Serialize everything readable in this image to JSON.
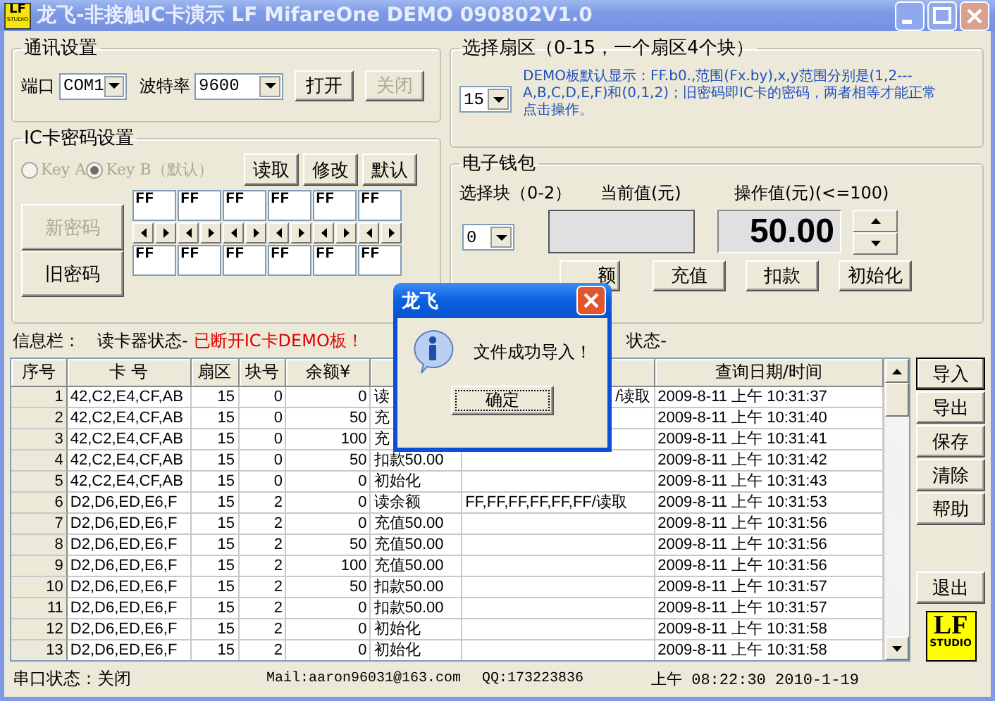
{
  "window": {
    "title": "龙飞-非接触IC卡演示 LF MifareOne DEMO 090802V1.0",
    "logo_top": "LF",
    "logo_bottom": "STUDIO"
  },
  "comm": {
    "title": "通讯设置",
    "port_label": "端口",
    "port": "COM1",
    "baud_label": "波特率",
    "baud": "9600",
    "buttons": [
      {
        "label": "打开",
        "disabled": false
      },
      {
        "label": "关闭",
        "disabled": true
      }
    ]
  },
  "password": {
    "title": "IC卡密码设置",
    "radios": [
      {
        "label": "Key A",
        "selected": false,
        "disabled": true
      },
      {
        "label": "Key B（默认）",
        "selected": true,
        "disabled": true
      }
    ],
    "buttons": [
      "读取",
      "修改",
      "默认"
    ],
    "new_button": {
      "label": "新密码",
      "disabled": true
    },
    "old_button": {
      "label": "旧密码",
      "disabled": false
    },
    "new_key": [
      "FF",
      "FF",
      "FF",
      "FF",
      "FF",
      "FF"
    ],
    "old_key": [
      "FF",
      "FF",
      "FF",
      "FF",
      "FF",
      "FF"
    ]
  },
  "sector": {
    "title": "选择扇区（0-15，一个扇区4个块）",
    "value": "15",
    "note": "DEMO板默认显示：FF.b0.,范围(Fx.by),x,y范围分别是(1,2---A,B,C,D,E,F)和(0,1,2)；旧密码即IC卡的密码，两者相等才能正常点击操作。"
  },
  "wallet": {
    "title": "电子钱包",
    "block_label": "选择块（0-2）",
    "current_label": "当前值(元)",
    "operate_label": "操作值(元)(<=100)",
    "block": "0",
    "amount": "50.00",
    "buttons": [
      "额",
      "充值",
      "扣款",
      "初始化"
    ]
  },
  "info": {
    "label": "信息栏：",
    "reader": "读卡器状态-",
    "status": "已断开IC卡DEMO板！",
    "status_tail": "状态-"
  },
  "table": {
    "columns": [
      {
        "label": "序号"
      },
      {
        "label": "卡 号"
      },
      {
        "label": "扇区"
      },
      {
        "label": "块号"
      },
      {
        "label": "余额¥"
      },
      {
        "kind": "hidden"
      },
      {
        "kind": "hidden"
      },
      {
        "label": "查询日期/时间"
      }
    ],
    "rows": [
      {
        "no": "1",
        "card": "42,C2,E4,CF,AB",
        "sector": "15",
        "block": "0",
        "balance": "0",
        "operation": "读",
        "data": "/读取",
        "time": "2009-8-11 上午 10:31:37"
      },
      {
        "no": "2",
        "card": "42,C2,E4,CF,AB",
        "sector": "15",
        "block": "0",
        "balance": "50",
        "operation": "充",
        "time": "2009-8-11 上午 10:31:40"
      },
      {
        "no": "3",
        "card": "42,C2,E4,CF,AB",
        "sector": "15",
        "block": "0",
        "balance": "100",
        "operation": "充",
        "time": "2009-8-11 上午 10:31:41"
      },
      {
        "no": "4",
        "card": "42,C2,E4,CF,AB",
        "sector": "15",
        "block": "0",
        "balance": "50",
        "operation": "扣款50.00",
        "time": "2009-8-11 上午 10:31:42"
      },
      {
        "no": "5",
        "card": "42,C2,E4,CF,AB",
        "sector": "15",
        "block": "0",
        "balance": "0",
        "operation": "初始化",
        "time": "2009-8-11 上午 10:31:43"
      },
      {
        "no": "6",
        "card": "D2,D6,ED,E6,F",
        "sector": "15",
        "block": "2",
        "balance": "0",
        "operation": "读余额",
        "data": "FF,FF,FF,FF,FF,FF/读取",
        "time": "2009-8-11 上午 10:31:53"
      },
      {
        "no": "7",
        "card": "D2,D6,ED,E6,F",
        "sector": "15",
        "block": "2",
        "balance": "0",
        "operation": "充值50.00",
        "time": "2009-8-11 上午 10:31:56"
      },
      {
        "no": "8",
        "card": "D2,D6,ED,E6,F",
        "sector": "15",
        "block": "2",
        "balance": "50",
        "operation": "充值50.00",
        "time": "2009-8-11 上午 10:31:56"
      },
      {
        "no": "9",
        "card": "D2,D6,ED,E6,F",
        "sector": "15",
        "block": "2",
        "balance": "100",
        "operation": "充值50.00",
        "time": "2009-8-11 上午 10:31:56"
      },
      {
        "no": "10",
        "card": "D2,D6,ED,E6,F",
        "sector": "15",
        "block": "2",
        "balance": "50",
        "operation": "扣款50.00",
        "time": "2009-8-11 上午 10:31:57"
      },
      {
        "no": "11",
        "card": "D2,D6,ED,E6,F",
        "sector": "15",
        "block": "2",
        "balance": "0",
        "operation": "扣款50.00",
        "time": "2009-8-11 上午 10:31:57"
      },
      {
        "no": "12",
        "card": "D2,D6,ED,E6,F",
        "sector": "15",
        "block": "2",
        "balance": "0",
        "operation": "初始化",
        "time": "2009-8-11 上午 10:31:58"
      },
      {
        "no": "13",
        "card": "D2,D6,ED,E6,F",
        "sector": "15",
        "block": "2",
        "balance": "0",
        "operation": "初始化",
        "time": "2009-8-11 上午 10:31:58"
      }
    ]
  },
  "side_buttons": [
    {
      "label": "导入",
      "focused": true
    },
    {
      "label": "导出",
      "focused": false
    },
    {
      "label": "保存",
      "focused": false
    },
    {
      "label": "清除",
      "focused": false
    },
    {
      "label": "帮助",
      "focused": false
    }
  ],
  "exit_button": "退出",
  "logo": {
    "top": "LF",
    "bottom": "STUDIO"
  },
  "status_bar": {
    "port": "串口状态：关闭",
    "mail": "Mail:aaron96031@163.com",
    "qq": "QQ:173223836",
    "clock": "上午 08:22:30 2010-1-19"
  },
  "dialog": {
    "title": "龙飞",
    "message": "文件成功导入！",
    "button": "确定"
  }
}
